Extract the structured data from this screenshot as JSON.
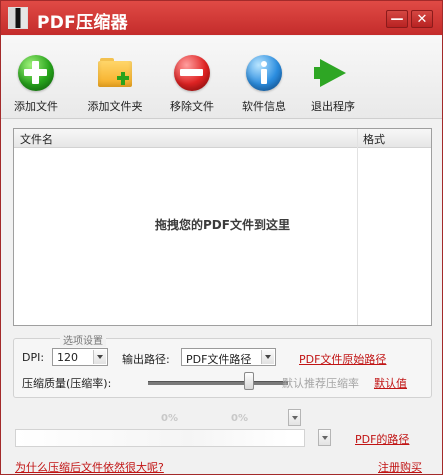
{
  "window": {
    "title": "PDF压缩器",
    "minimize": "—",
    "close": "✕"
  },
  "toolbar": {
    "items": [
      {
        "label": "添加文件"
      },
      {
        "label": "添加文件夹"
      },
      {
        "label": "移除文件"
      },
      {
        "label": "软件信息"
      },
      {
        "label": "退出程序"
      }
    ]
  },
  "file_list": {
    "headers": {
      "name": "文件名",
      "format": "格式"
    },
    "empty_text": "拖拽您的PDF文件到这里"
  },
  "options": {
    "title": "选项设置",
    "dpi_label": "DPI:",
    "dpi_value": "120",
    "output_label": "输出路径:",
    "output_value": "PDF文件路径",
    "original_path_link": "PDF文件原始路径",
    "quality_label": "压缩质量(压缩率):",
    "recommended": "默认推荐压缩率",
    "default_link": "默认值"
  },
  "progress": {
    "pct1": "0%",
    "pct2": "0%",
    "path_link": "PDF的路径"
  },
  "footer": {
    "why_link": "为什么压缩后文件依然很大呢?",
    "register_link": "注册购买"
  }
}
